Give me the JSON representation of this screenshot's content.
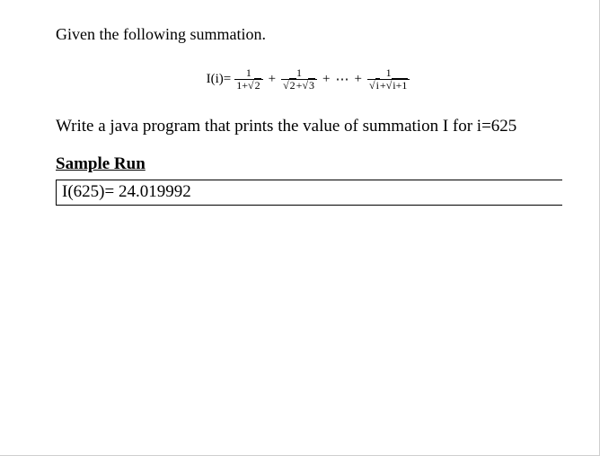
{
  "intro": "Given the following summation.",
  "formula": {
    "lhs": "I(i)=",
    "terms": [
      {
        "num": "1",
        "den_plain_left": "1",
        "den_sqrt_right": "2"
      },
      {
        "num": "1",
        "den_sqrt_left": "2",
        "den_sqrt_right": "3"
      },
      {
        "num": "1",
        "den_sqrt_left": "i",
        "den_sqrt_right": "i+1"
      }
    ],
    "plus": "+",
    "dots": "⋯"
  },
  "task": "Write a java program that prints the value of summation I for i=625",
  "sample_heading": "Sample Run",
  "sample_output": "I(625)= 24.019992"
}
